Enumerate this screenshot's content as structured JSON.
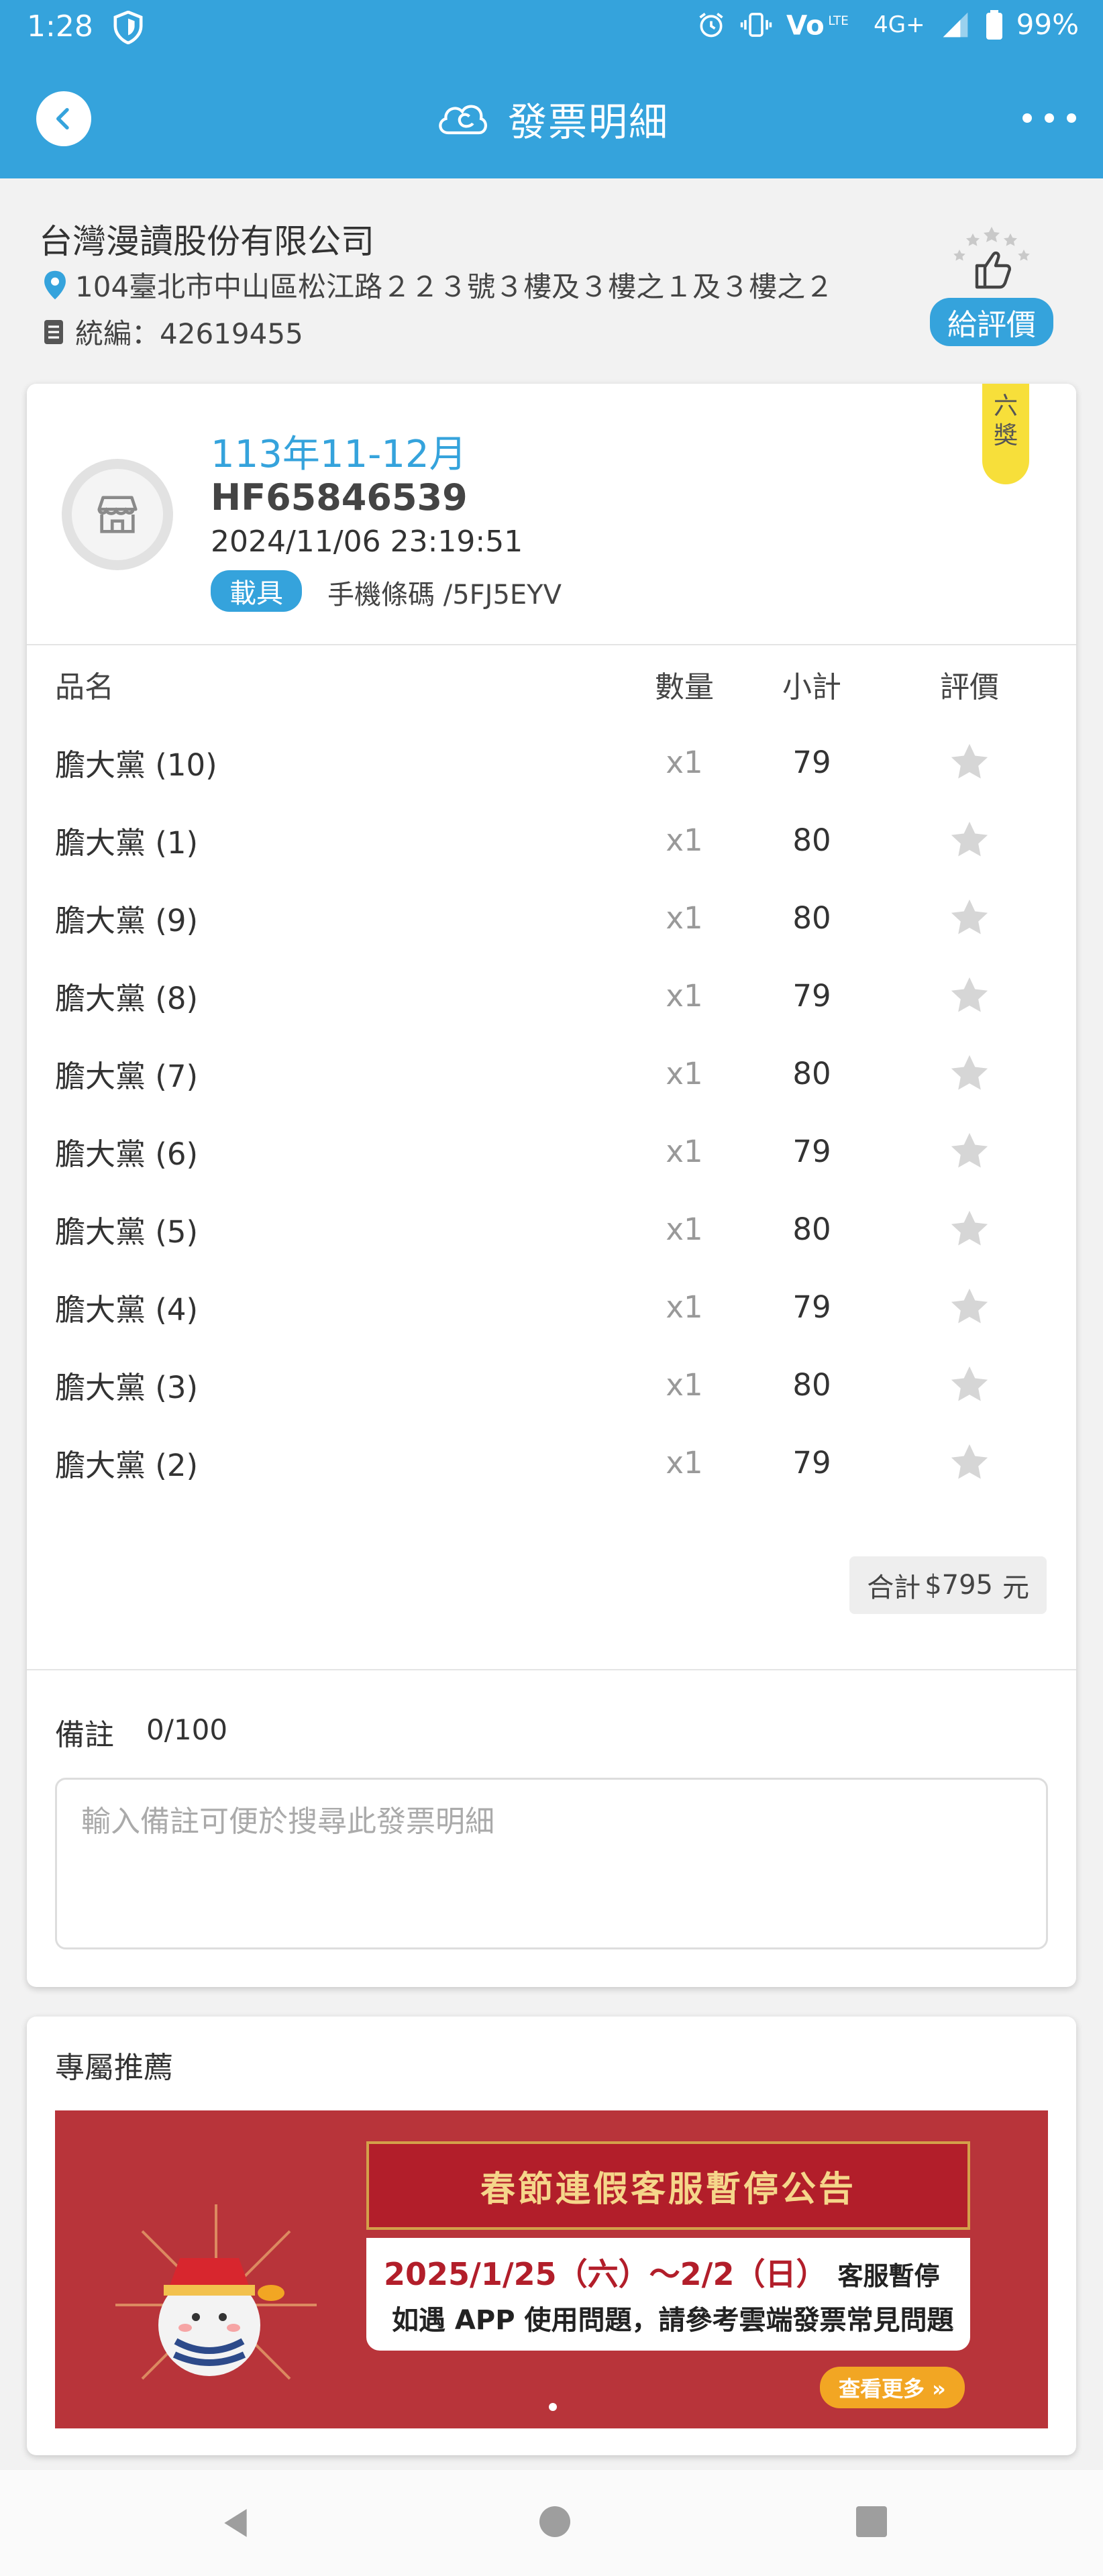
{
  "status_bar": {
    "time": "1:28",
    "network": "4G+",
    "battery": "99%",
    "icons": [
      "shield-icon",
      "alarm-icon",
      "vibrate-icon",
      "volte-icon",
      "signal-icon",
      "battery-icon"
    ]
  },
  "header": {
    "title": "發票明細",
    "back_icon": "chevron-left-icon",
    "logo_icon": "cloud-e-logo-icon",
    "more_icon": "more-dots-icon"
  },
  "store": {
    "name": "台灣漫讀股份有限公司",
    "address": "104臺北市中山區松江路２２３號３樓及３樓之１及３樓之２",
    "tax_id_label": "統編：",
    "tax_id": "42619455",
    "rate_button": "給評價"
  },
  "invoice": {
    "period": "113年11-12月",
    "number": "HF65846539",
    "datetime": "2024/11/06 23:19:51",
    "carrier_tag": "載具",
    "carrier_value": "手機條碼 /5FJ5EYV",
    "prize_badge": "六獎"
  },
  "items_table": {
    "headers": {
      "name": "品名",
      "qty": "數量",
      "subtotal": "小計",
      "rating": "評價"
    },
    "rows": [
      {
        "name": "膽大黨 (10)",
        "qty": "x1",
        "subtotal": "79"
      },
      {
        "name": "膽大黨 (1)",
        "qty": "x1",
        "subtotal": "80"
      },
      {
        "name": "膽大黨 (9)",
        "qty": "x1",
        "subtotal": "80"
      },
      {
        "name": "膽大黨 (8)",
        "qty": "x1",
        "subtotal": "79"
      },
      {
        "name": "膽大黨 (7)",
        "qty": "x1",
        "subtotal": "80"
      },
      {
        "name": "膽大黨 (6)",
        "qty": "x1",
        "subtotal": "79"
      },
      {
        "name": "膽大黨 (5)",
        "qty": "x1",
        "subtotal": "80"
      },
      {
        "name": "膽大黨 (4)",
        "qty": "x1",
        "subtotal": "79"
      },
      {
        "name": "膽大黨 (3)",
        "qty": "x1",
        "subtotal": "80"
      },
      {
        "name": "膽大黨 (2)",
        "qty": "x1",
        "subtotal": "79"
      }
    ],
    "total_label": "合計",
    "total_value": "$795",
    "total_unit": "元"
  },
  "note": {
    "label": "備註",
    "count": "0/100",
    "placeholder": "輸入備註可便於搜尋此發票明細"
  },
  "recommend": {
    "title": "專屬推薦",
    "banner_title": "春節連假客服暫停公告",
    "banner_line1_main": "2025/1/25（六）～2/2（日）",
    "banner_line1_suffix": "客服暫停",
    "banner_line2": "如遇 APP 使用問題，請參考雲端發票常見問題",
    "banner_more": "查看更多 »"
  },
  "colors": {
    "primary": "#35a3dc",
    "star_gray": "#d6d6d6",
    "prize_yellow": "#f7df3a",
    "banner_red": "#b8343a"
  }
}
